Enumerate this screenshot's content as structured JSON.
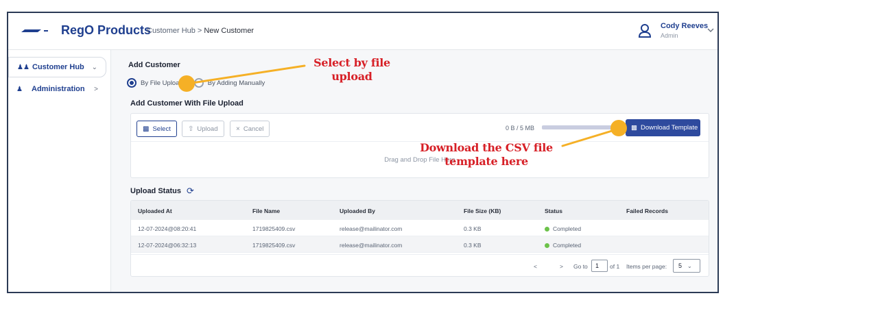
{
  "header": {
    "brand": "RegO Products",
    "breadcrumb": [
      "Customer Hub",
      "New Customer"
    ],
    "user_name": "Cody Reeves",
    "user_role": "Admin"
  },
  "sidebar": {
    "items": [
      {
        "label": "Customer Hub",
        "icon": "users-icon",
        "expanded": true
      },
      {
        "label": "Administration",
        "icon": "person-icon",
        "expanded": false
      }
    ]
  },
  "main": {
    "add_title": "Add Customer",
    "radio_file": "By File Upload",
    "radio_manual": "By Adding Manually",
    "upload_title": "Add Customer With File Upload",
    "buttons": {
      "select": "Select",
      "upload": "Upload",
      "cancel": "Cancel"
    },
    "size_text": "0 B / 5 MB",
    "size_progress": 0,
    "download_label": "Download Template",
    "drop_text": "Drag and Drop File Here",
    "status_title": "Upload Status",
    "table": {
      "headers": [
        "Uploaded At",
        "File Name",
        "Uploaded By",
        "File Size (KB)",
        "Status",
        "Failed Records"
      ],
      "rows": [
        [
          "12-07-2024@08:20:41",
          "1719825409.csv",
          "release@mailinator.com",
          "0.3 KB",
          "Completed",
          ""
        ],
        [
          "12-07-2024@06:32:13",
          "1719825409.csv",
          "release@mailinator.com",
          "0.3 KB",
          "Completed",
          ""
        ]
      ]
    },
    "pager": {
      "goto_label": "Go to",
      "page": "1",
      "of_label": "of 1",
      "per_page_label": "Items per page:",
      "per_page": "5"
    }
  },
  "annotations": {
    "select_callout": [
      "Select by file",
      "upload"
    ],
    "download_callout": [
      "Download the CSV file",
      "template here"
    ]
  },
  "colors": {
    "accent": "#1f3f8f",
    "button": "#2e4a9e",
    "callout": "#d72027",
    "marker": "#f5b026",
    "success": "#6cc24a"
  }
}
